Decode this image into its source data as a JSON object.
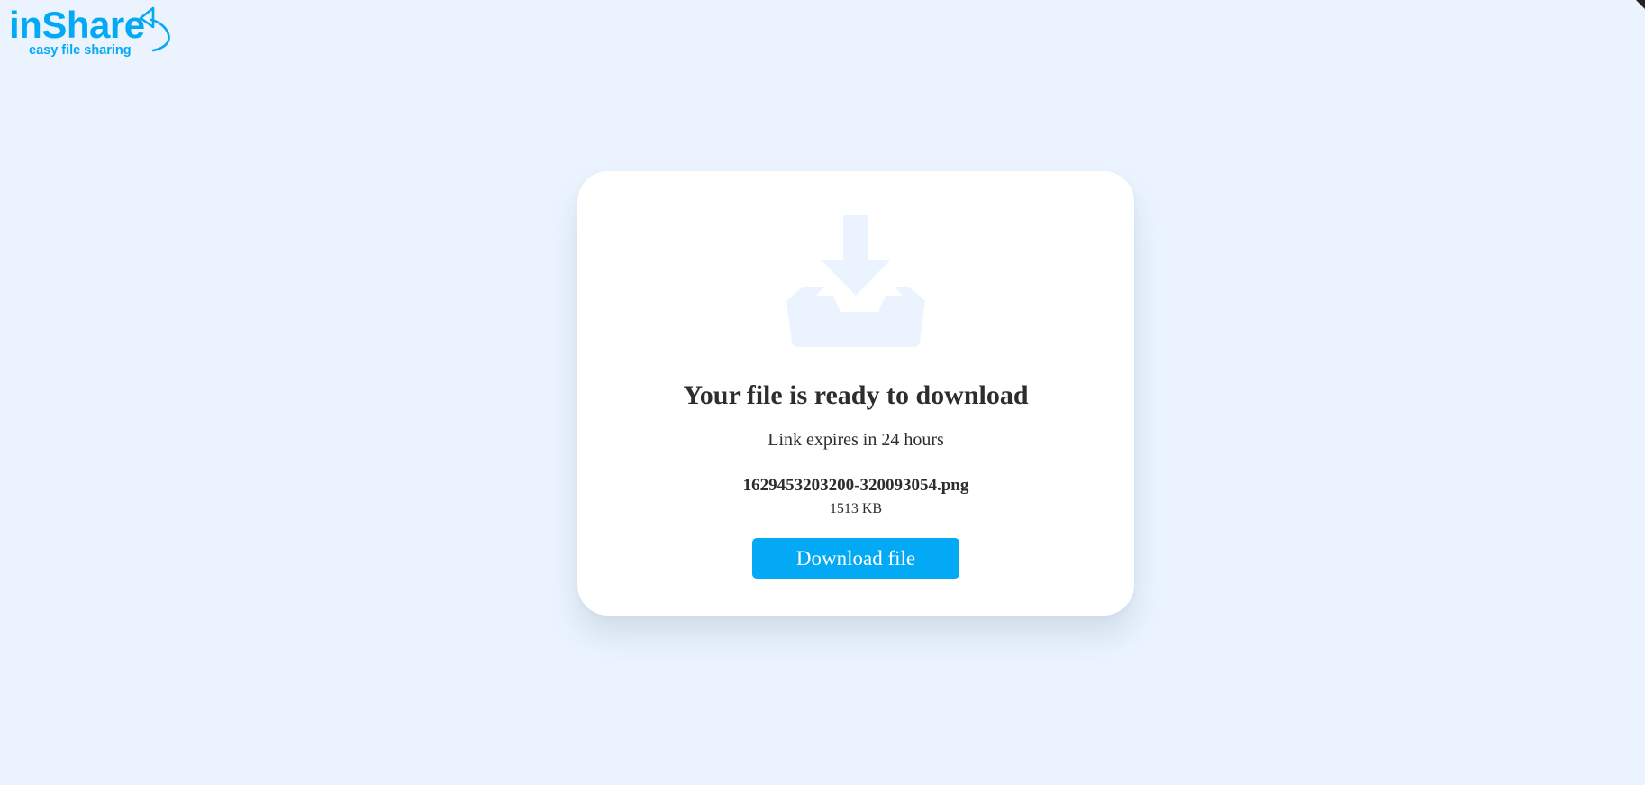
{
  "brand": {
    "name": "inShare",
    "tagline": "easy file sharing",
    "logo_icon": "arrow-swoosh-icon",
    "color": "#03a9f4"
  },
  "download": {
    "icon": "download-tray-icon",
    "title": "Your file is ready to download",
    "expiry_text": "Link expires in 24 hours",
    "file_name": "1629453203200-320093054.png",
    "file_size": "1513 KB",
    "button_label": "Download file"
  },
  "colors": {
    "background": "#ebf4fe",
    "card": "#ffffff",
    "accent": "#03a9f4",
    "icon": "#ebf4fe",
    "text": "#2d2d2d"
  }
}
